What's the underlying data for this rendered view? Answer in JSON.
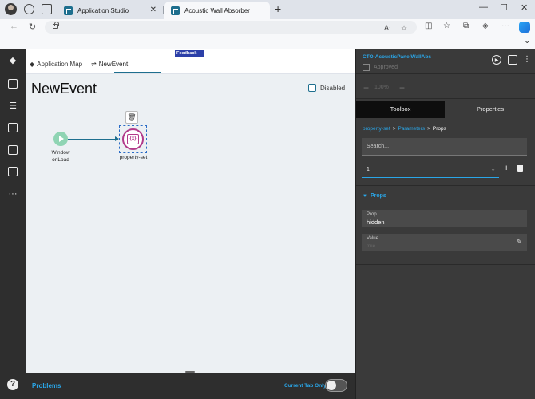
{
  "browser": {
    "tabs": [
      {
        "title": "Application Studio",
        "active": false
      },
      {
        "title": "Acoustic Wall Absorber",
        "active": true
      }
    ],
    "new_tab_icon": "plus-icon"
  },
  "canvas_tabs": {
    "app_map": "Application Map",
    "new_event": "NewEvent"
  },
  "feedback": "Feedback",
  "canvas": {
    "title": "NewEvent",
    "disabled_label": "Disabled",
    "nodes": {
      "start_label_line1": "Window",
      "start_label_line2": "onLoad",
      "prop_label": "property-set",
      "prop_glyph": "{x}"
    }
  },
  "bottom_bar": {
    "problems": "Problems",
    "current_tab_only": "Current Tab Only"
  },
  "right_panel": {
    "title": "CTO-AcousticPanelWallAbs",
    "approved": "Approved",
    "zoom": "100%",
    "tabs": {
      "toolbox": "Toolbox",
      "properties": "Properties"
    },
    "breadcrumb": {
      "first": "property-set",
      "second": "Parameters",
      "current": "Props",
      "sep": ">"
    },
    "search_placeholder": "Search...",
    "select_value": "1",
    "props_header": "Props",
    "prop_field": {
      "label": "Prop",
      "value": "hidden"
    },
    "value_field": {
      "label": "Value",
      "placeholder": "true"
    }
  }
}
